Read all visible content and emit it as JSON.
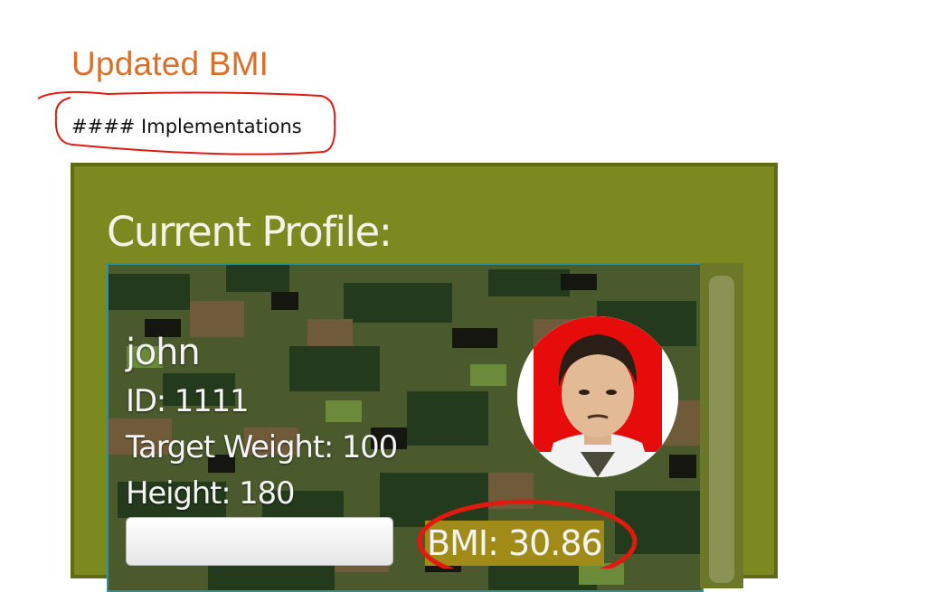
{
  "document": {
    "title": "Updated BMI",
    "subtitle": "#### Implementations"
  },
  "colors": {
    "title": "#d9702a",
    "app_background": "#7c8920",
    "annotation": "#e01a0f",
    "bmi_highlight": "#a08a18"
  },
  "app": {
    "heading": "Current Profile:",
    "profile": {
      "name": "john",
      "id": "ID: 1111",
      "target_weight": "Target Weight: 100",
      "height": "Height: 180",
      "bmi": "BMI: 30.86"
    }
  },
  "icons": {
    "avatar": "profile-photo",
    "annotations": [
      "red-freehand-outline",
      "red-ellipse"
    ]
  }
}
